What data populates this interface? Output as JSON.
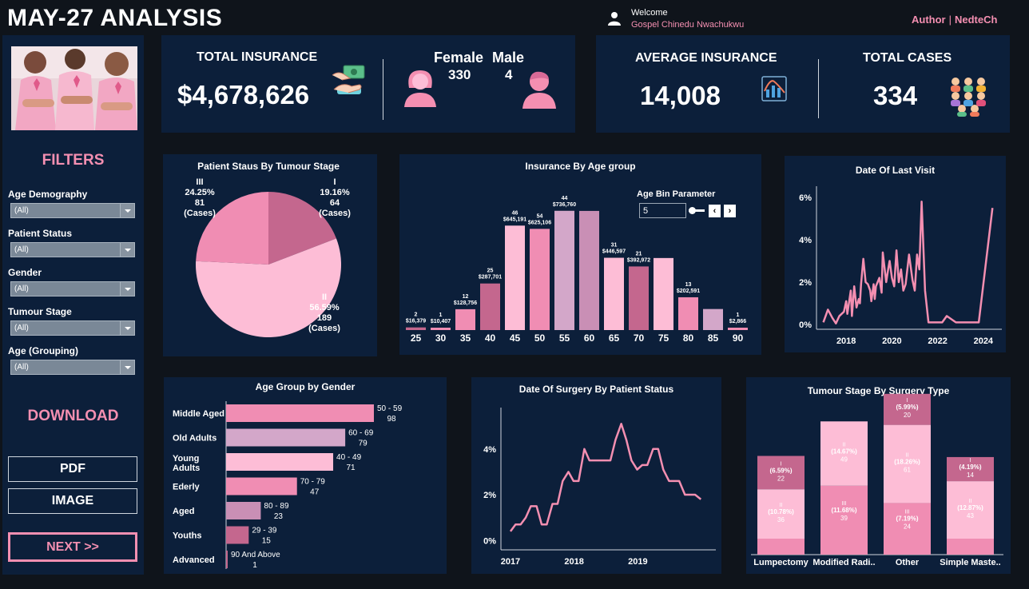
{
  "header": {
    "title": "MAY-27 ANALYSIS",
    "welcome": "Welcome",
    "user_name": "Gospel Chinedu Nwachukwu",
    "author_label": "Author",
    "author_name": "NedteCh"
  },
  "sidebar": {
    "filters_title": "FILTERS",
    "filters": [
      {
        "label": "Age Demography",
        "value": "(All)"
      },
      {
        "label": "Patient Status",
        "value": "(All)"
      },
      {
        "label": "Gender",
        "value": "(All)"
      },
      {
        "label": "Tumour Stage",
        "value": "(All)"
      },
      {
        "label": "Age (Grouping)",
        "value": "(All)"
      }
    ],
    "download_title": "DOWNLOAD",
    "pdf_label": "PDF",
    "image_label": "IMAGE",
    "next_label": "NEXT >>"
  },
  "kpis": {
    "total_insurance_label": "TOTAL INSURANCE",
    "total_insurance_value": "$4,678,626",
    "female_label": "Female",
    "female_value": "330",
    "male_label": "Male",
    "male_value": "4",
    "average_insurance_label": "AVERAGE INSURANCE",
    "average_insurance_value": "14,008",
    "total_cases_label": "TOTAL CASES",
    "total_cases_value": "334"
  },
  "colors": {
    "panel": "#0c1f3a",
    "pink_dark": "#c4678e",
    "pink_mid": "#f08db3",
    "pink_light": "#fdbdd6",
    "mauve": "#d3a7c9",
    "accent": "#f48fb1"
  },
  "chart_data": [
    {
      "id": "pie",
      "type": "pie",
      "title": "Patient Staus By Tumour Stage",
      "slices": [
        {
          "label": "I",
          "percent": "19.16%",
          "value": 64,
          "unit": "(Cases)"
        },
        {
          "label": "II",
          "percent": "56.59%",
          "value": 189,
          "unit": "(Cases)"
        },
        {
          "label": "III",
          "percent": "24.25%",
          "value": 81,
          "unit": "(Cases)"
        }
      ]
    },
    {
      "id": "age_bars",
      "type": "bar",
      "title": "Insurance By Age group",
      "parameter_label": "Age Bin Parameter",
      "parameter_value": "5",
      "categories": [
        "25",
        "30",
        "35",
        "40",
        "45",
        "50",
        "55",
        "60",
        "65",
        "70",
        "75",
        "80",
        "85",
        "90"
      ],
      "counts": [
        "2",
        "1",
        "12",
        "25",
        "46",
        "54",
        "44",
        "",
        "31",
        "21",
        "",
        "13",
        "",
        "1"
      ],
      "amounts": [
        "$16,379",
        "$10,407",
        "$128,756",
        "$287,701",
        "$645,191",
        "$625,106",
        "$736,760",
        "",
        "$446,597",
        "$392,972",
        "",
        "$202,591",
        "",
        "$2,866"
      ],
      "values": [
        16379,
        10407,
        128756,
        287701,
        645191,
        625106,
        736760,
        736000,
        446597,
        392972,
        445000,
        202591,
        130000,
        2866
      ]
    },
    {
      "id": "last_visit",
      "type": "line",
      "title": "Date Of Last Visit",
      "x_ticks": [
        "2018",
        "2020",
        "2022",
        "2024"
      ],
      "y_ticks": [
        "0%",
        "2%",
        "4%",
        "6%"
      ],
      "ylim": [
        0,
        6.3
      ],
      "xlim": [
        2016.7,
        2024.6
      ],
      "x": [
        2017.0,
        2017.2,
        2017.4,
        2017.55,
        2017.7,
        2017.9,
        2018.0,
        2018.05,
        2018.2,
        2018.25,
        2018.35,
        2018.45,
        2018.55,
        2018.6,
        2018.65,
        2018.75,
        2018.85,
        2018.95,
        2019.05,
        2019.1,
        2019.2,
        2019.25,
        2019.3,
        2019.45,
        2019.55,
        2019.6,
        2019.75,
        2019.85,
        2019.9,
        2020.0,
        2020.1,
        2020.2,
        2020.3,
        2020.4,
        2020.5,
        2020.6,
        2020.75,
        2020.9,
        2021.0,
        2021.1,
        2021.2,
        2021.3,
        2021.45,
        2021.6,
        2021.8,
        2022.0,
        2022.2,
        2022.4,
        2022.8,
        2023.2,
        2023.6,
        2023.8,
        2024.4
      ],
      "y": [
        0.1,
        0.7,
        0.3,
        0.05,
        0.4,
        0.6,
        1.1,
        0.5,
        1.6,
        0.4,
        1.8,
        0.8,
        1.2,
        1.0,
        1.9,
        3.1,
        2.0,
        1.9,
        1.6,
        1.1,
        1.9,
        1.2,
        1.8,
        2.2,
        1.5,
        3.4,
        2.0,
        2.7,
        3.0,
        2.2,
        1.8,
        3.5,
        2.0,
        2.6,
        1.6,
        1.9,
        3.3,
        2.1,
        1.6,
        3.3,
        2.6,
        5.8,
        1.6,
        0.1,
        0.1,
        0.1,
        0.1,
        0.4,
        0.1,
        0.1,
        0.1,
        0.1,
        5.5
      ]
    },
    {
      "id": "age_gender",
      "type": "bar",
      "title": "Age Group by Gender",
      "categories": [
        "Middle Aged",
        "Old Adults",
        "Young Adults",
        "Ederly",
        "Aged",
        "Youths",
        "Advanced"
      ],
      "ranges": [
        "50 - 59",
        "60 - 69",
        "40 - 49",
        "70 - 79",
        "80 - 89",
        "29 - 39",
        "90 And Above"
      ],
      "values": [
        98,
        79,
        71,
        47,
        23,
        15,
        1
      ]
    },
    {
      "id": "surgery_date",
      "type": "line",
      "title": "Date Of Surgery By Patient Status",
      "x_ticks": [
        "2017",
        "2018",
        "2019"
      ],
      "y_ticks": [
        "0%",
        "2%",
        "4%"
      ],
      "ylim": [
        -0.2,
        5.6
      ],
      "xlim": [
        2016.85,
        2020.15
      ],
      "x": [
        2017.0,
        2017.08,
        2017.16,
        2017.24,
        2017.32,
        2017.41,
        2017.49,
        2017.57,
        2017.66,
        2017.74,
        2017.82,
        2017.91,
        2017.99,
        2018.07,
        2018.16,
        2018.24,
        2018.32,
        2018.4,
        2018.49,
        2018.57,
        2018.65,
        2018.74,
        2018.82,
        2018.9,
        2018.99,
        2019.07,
        2019.15,
        2019.24,
        2019.32,
        2019.4,
        2019.49,
        2019.57,
        2019.65,
        2019.74,
        2019.82,
        2019.9,
        2019.99
      ],
      "y": [
        0.4,
        0.7,
        0.7,
        1.0,
        1.5,
        1.5,
        0.7,
        0.7,
        1.6,
        1.6,
        2.6,
        3.0,
        2.6,
        2.6,
        4.0,
        3.5,
        3.5,
        3.5,
        3.5,
        3.5,
        4.4,
        5.1,
        4.4,
        3.5,
        3.1,
        3.3,
        3.3,
        4.0,
        4.0,
        3.1,
        2.6,
        2.6,
        2.6,
        2.0,
        2.0,
        2.0,
        1.8
      ]
    },
    {
      "id": "tumour_surgery",
      "type": "bar",
      "title": "Tumour Stage By Surgery Type",
      "categories": [
        "Lumpectomy",
        "Modified Radi..",
        "Other",
        "Simple Maste.."
      ],
      "segments": [
        [
          {
            "stage": "II",
            "pct": "(10.78%)",
            "value": 36
          },
          {
            "stage": "I",
            "pct": "(6.59%)",
            "value": 22
          }
        ],
        [
          {
            "stage": "III",
            "pct": "(11.68%)",
            "value": 39
          },
          {
            "stage": "II",
            "pct": "(14.67%)",
            "value": 49
          }
        ],
        [
          {
            "stage": "III",
            "pct": "(7.19%)",
            "value": 24
          },
          {
            "stage": "II",
            "pct": "(18.26%)",
            "value": 61
          },
          {
            "stage": "I",
            "pct": "(5.99%)",
            "value": 20
          }
        ],
        [
          {
            "stage": "II",
            "pct": "(12.87%)",
            "value": 43
          },
          {
            "stage": "I",
            "pct": "(4.19%)",
            "value": 14
          }
        ]
      ]
    }
  ]
}
